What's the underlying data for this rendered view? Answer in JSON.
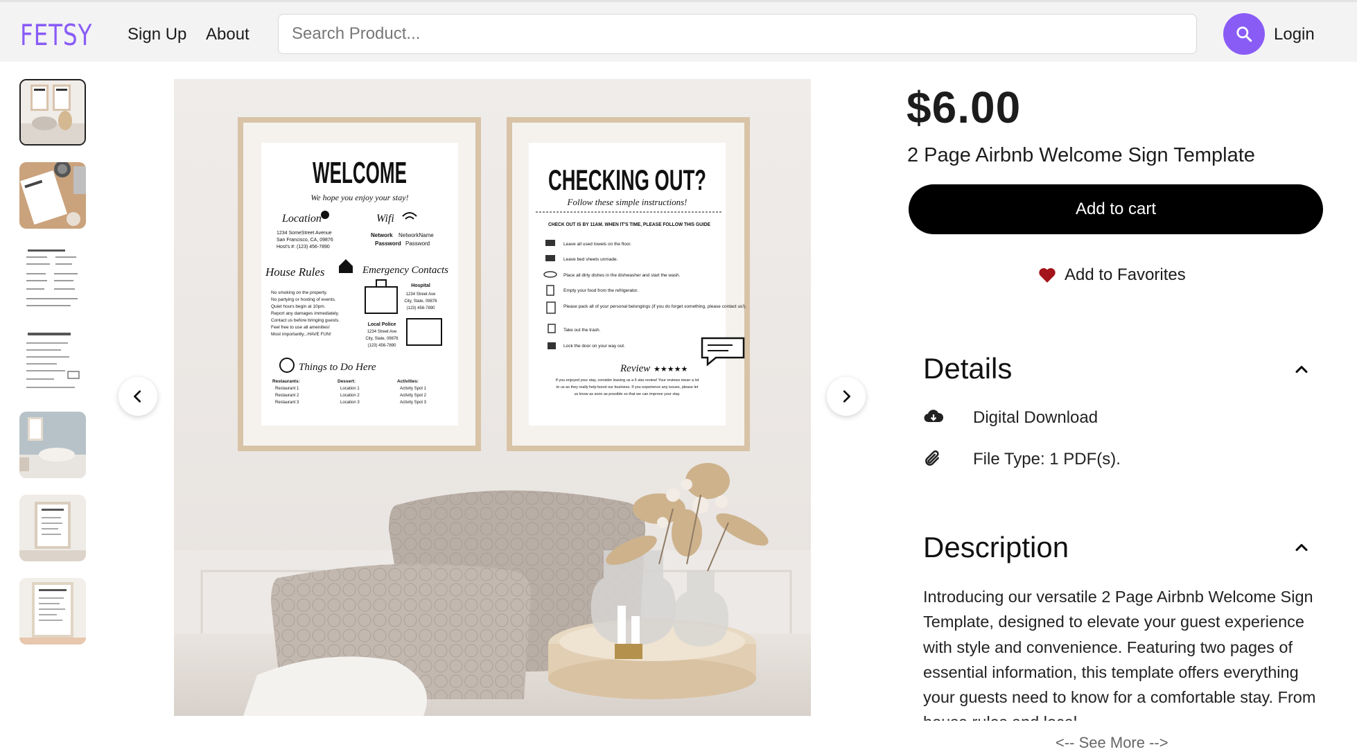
{
  "header": {
    "logo": "FETSY",
    "nav": {
      "signup": "Sign Up",
      "about": "About"
    },
    "search": {
      "placeholder": "Search Product...",
      "value": ""
    },
    "search_icon": "search-icon",
    "login": "Login"
  },
  "gallery": {
    "thumbnail_count": 7,
    "active_index": 0,
    "main_image": {
      "welcome": {
        "heading": "WELCOME",
        "tagline": "We hope you enjoy your stay!",
        "location_label": "Location",
        "location_lines": [
          "1234 SomeStreet Avenue",
          "San Francisco, CA, 09876",
          "Host's #: (123) 456-7890"
        ],
        "wifi_label": "Wifi",
        "network_key": "Network",
        "network_value": "NetworkName",
        "password_key": "Password",
        "password_value": "Password",
        "house_rules_label": "House Rules",
        "house_rules": [
          "No smoking on the property.",
          "No partying or hosting of events.",
          "Quiet hours begin at 10pm.",
          "Report any damages immediately.",
          "Contact us before bringing guests.",
          "Feel free to use all amenities!",
          "Most importantly...HAVE FUN!"
        ],
        "emergency_label": "Emergency Contacts",
        "hospital_label": "Hospital",
        "hospital_lines": [
          "1234 Street Ave",
          "City, State, 09876",
          "(123) 456-7890"
        ],
        "police_label": "Local Police",
        "police_lines": [
          "1234 Street Ave",
          "City, State, 09876",
          "(123) 456-7890"
        ],
        "todo_label": "Things to Do Here",
        "todo_columns": [
          {
            "title": "Restaurants:",
            "items": [
              "Restaurant 1",
              "Restaurant 2",
              "Restaurant 3"
            ]
          },
          {
            "title": "Dessert:",
            "items": [
              "Location 1",
              "Location 2",
              "Location 3"
            ]
          },
          {
            "title": "Activities:",
            "items": [
              "Activity Spot 1",
              "Activity Spot 2",
              "Activity Spot 3"
            ]
          }
        ]
      },
      "checkout": {
        "heading": "CHECKING OUT?",
        "tagline": "Follow these simple instructions!",
        "guide_line": "CHECK OUT IS BY 11AM. WHEN IT'S TIME, PLEASE FOLLOW THIS GUIDE",
        "steps": [
          "Leave all used towels on the floor.",
          "Leave bed sheets unmade.",
          "Place all dirty dishes in the dishwasher and start the wash.",
          "Empty your food from the refrigerator.",
          "Please pack all of your personal belongings (if you do forget something, please contact us!).",
          "Take out the trash.",
          "Lock the door on your way out."
        ],
        "review_label": "Review",
        "review_stars": "★★★★★",
        "review_lines": [
          "If you enjoyed your stay, consider leaving us a 5 star review! Your reviews mean a lot",
          "to us as they really help boost our business. If you experience any issues, please let",
          "us know as soon as possible so that we can improve your stay."
        ]
      }
    },
    "prev_icon": "chevron-left-icon",
    "next_icon": "chevron-right-icon"
  },
  "product": {
    "price": "$6.00",
    "title": "2 Page Airbnb Welcome Sign Template",
    "add_to_cart": "Add to cart",
    "favorites": "Add to Favorites",
    "favorite_color": "#a3141b",
    "details": {
      "heading": "Details",
      "items": [
        {
          "icon": "cloud-download-icon",
          "text": "Digital Download"
        },
        {
          "icon": "paperclip-icon",
          "text": "File Type: 1 PDF(s)."
        }
      ]
    },
    "description": {
      "heading": "Description",
      "text": "Introducing our versatile 2 Page Airbnb Welcome Sign Template, designed to elevate your guest experience with style and convenience. Featuring two pages of essential information, this template offers everything your guests need to know for a comfortable stay. From house rules and local",
      "see_more": "<-- See More -->"
    }
  },
  "colors": {
    "accent": "#8a5cf6",
    "header_bg": "#f3f3f4",
    "button_bg": "#000000"
  }
}
